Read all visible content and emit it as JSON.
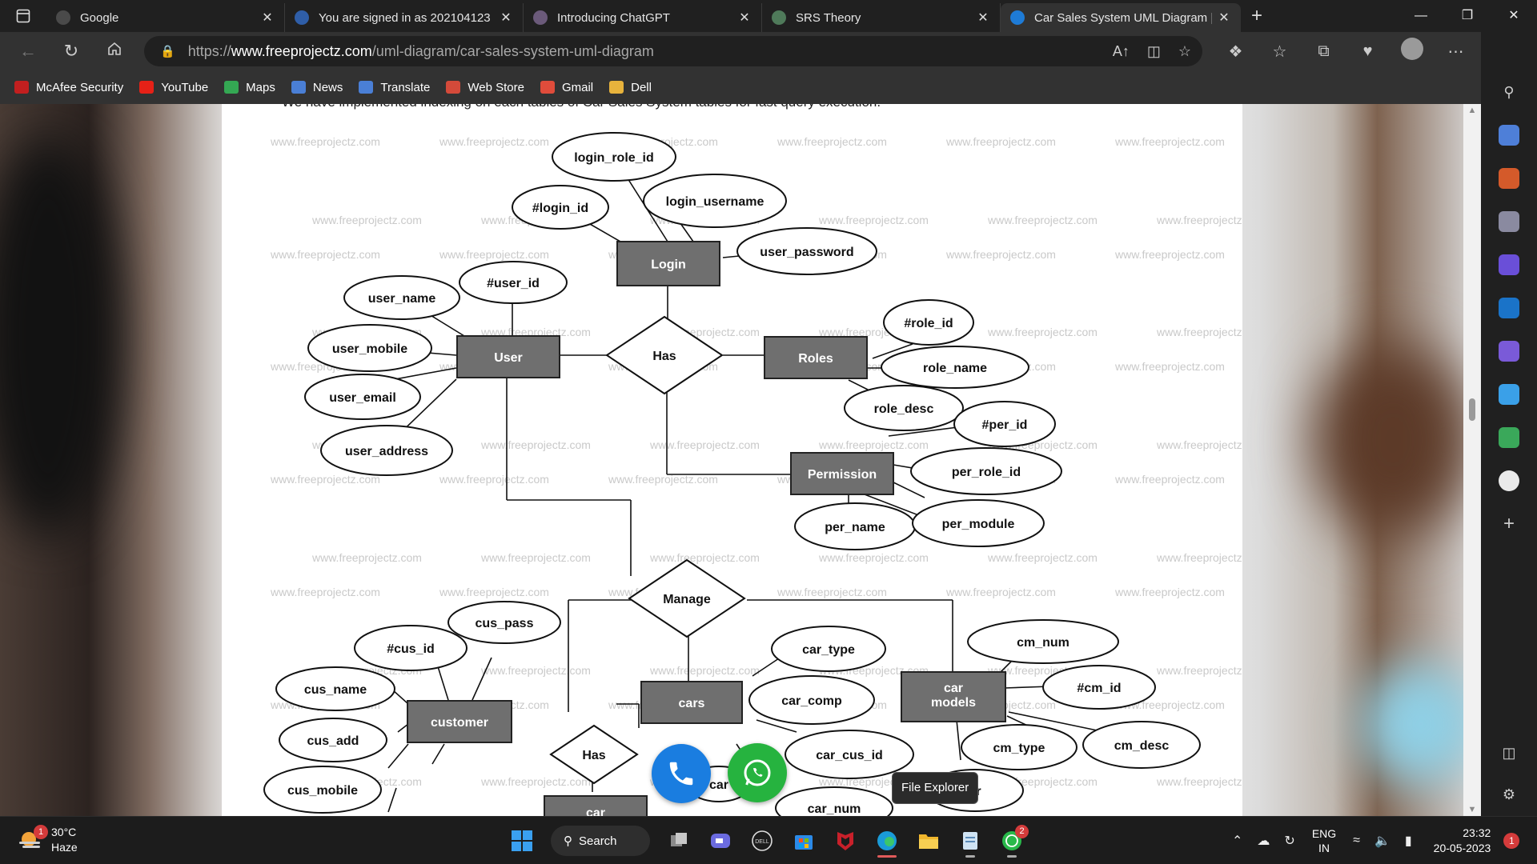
{
  "tabs": [
    {
      "title": "Google",
      "favicon_color": "#4a4a4a"
    },
    {
      "title": "You are signed in as 202104123",
      "favicon_color": "#2f5ea8"
    },
    {
      "title": "Introducing ChatGPT",
      "favicon_color": "#6b5a7a"
    },
    {
      "title": "SRS Theory",
      "favicon_color": "#4f7a5a"
    },
    {
      "title": "Car Sales System UML Diagram |",
      "favicon_color": "#1e7bd6"
    }
  ],
  "address": {
    "protocol": "https://",
    "host": "www.freeprojectz.com",
    "path": "/uml-diagram/car-sales-system-uml-diagram"
  },
  "favorites": [
    {
      "label": "McAfee Security",
      "color": "#c21f1f"
    },
    {
      "label": "YouTube",
      "color": "#e62117"
    },
    {
      "label": "Maps",
      "color": "#34a853"
    },
    {
      "label": "News",
      "color": "#4a7fd6"
    },
    {
      "label": "Translate",
      "color": "#4a7fd6"
    },
    {
      "label": "Web Store",
      "color": "#d44a3a"
    },
    {
      "label": "Gmail",
      "color": "#e04c3b"
    },
    {
      "label": "Dell",
      "color": "#e8b33c"
    }
  ],
  "page": {
    "intro": "We have implemented indexing on each tables of Car Sales System tables for fast query execution.",
    "watermark": "www.freeprojectz.com"
  },
  "diagram": {
    "entities": [
      {
        "id": "login",
        "label": "Login"
      },
      {
        "id": "user",
        "label": "User"
      },
      {
        "id": "roles",
        "label": "Roles"
      },
      {
        "id": "permission",
        "label": "Permission"
      },
      {
        "id": "customer",
        "label": "customer"
      },
      {
        "id": "cars",
        "label": "cars"
      },
      {
        "id": "car_models",
        "label": "car models"
      },
      {
        "id": "car_bottom",
        "label": "car"
      }
    ],
    "relationships": [
      {
        "id": "has_top",
        "label": "Has"
      },
      {
        "id": "manage",
        "label": "Manage"
      },
      {
        "id": "has_bottom",
        "label": "Has"
      }
    ],
    "attributes": [
      {
        "id": "login_role_id",
        "label": "login_role_id"
      },
      {
        "id": "login_id",
        "label": "#login_id"
      },
      {
        "id": "login_username",
        "label": "login_username"
      },
      {
        "id": "user_password",
        "label": "user_password"
      },
      {
        "id": "user_name",
        "label": "user_name"
      },
      {
        "id": "user_id",
        "label": "#user_id"
      },
      {
        "id": "user_mobile",
        "label": "user_mobile"
      },
      {
        "id": "user_email",
        "label": "user_email"
      },
      {
        "id": "user_address",
        "label": "user_address"
      },
      {
        "id": "role_id",
        "label": "#role_id"
      },
      {
        "id": "role_name",
        "label": "role_name"
      },
      {
        "id": "role_desc",
        "label": "role_desc"
      },
      {
        "id": "per_id",
        "label": "#per_id"
      },
      {
        "id": "per_role_id",
        "label": "per_role_id"
      },
      {
        "id": "per_name",
        "label": "per_name"
      },
      {
        "id": "per_module",
        "label": "per_module"
      },
      {
        "id": "cus_pass",
        "label": "cus_pass"
      },
      {
        "id": "cus_id",
        "label": "#cus_id"
      },
      {
        "id": "cus_name",
        "label": "cus_name"
      },
      {
        "id": "cus_add",
        "label": "cus_add"
      },
      {
        "id": "cus_mobile",
        "label": "cus_mobile"
      },
      {
        "id": "car_type",
        "label": "car_type"
      },
      {
        "id": "car_comp",
        "label": "car_comp"
      },
      {
        "id": "car_cus_id",
        "label": "car_cus_id"
      },
      {
        "id": "car_num",
        "label": "car_num"
      },
      {
        "id": "car_partial",
        "label": "car"
      },
      {
        "id": "cm_num",
        "label": "cm_num"
      },
      {
        "id": "cm_id",
        "label": "#cm_id"
      },
      {
        "id": "cm_type",
        "label": "cm_type"
      },
      {
        "id": "cm_desc",
        "label": "cm_desc"
      },
      {
        "id": "cm_partial",
        "label": "ar"
      }
    ]
  },
  "tooltip": "File Explorer",
  "taskbar": {
    "weather_temp": "30°C",
    "weather_desc": "Haze",
    "weather_badge": "1",
    "search_label": "Search",
    "whatsapp_badge": "2",
    "lang_top": "ENG",
    "lang_bottom": "IN",
    "time": "23:32",
    "date": "20-05-2023",
    "notification_count": "1"
  }
}
